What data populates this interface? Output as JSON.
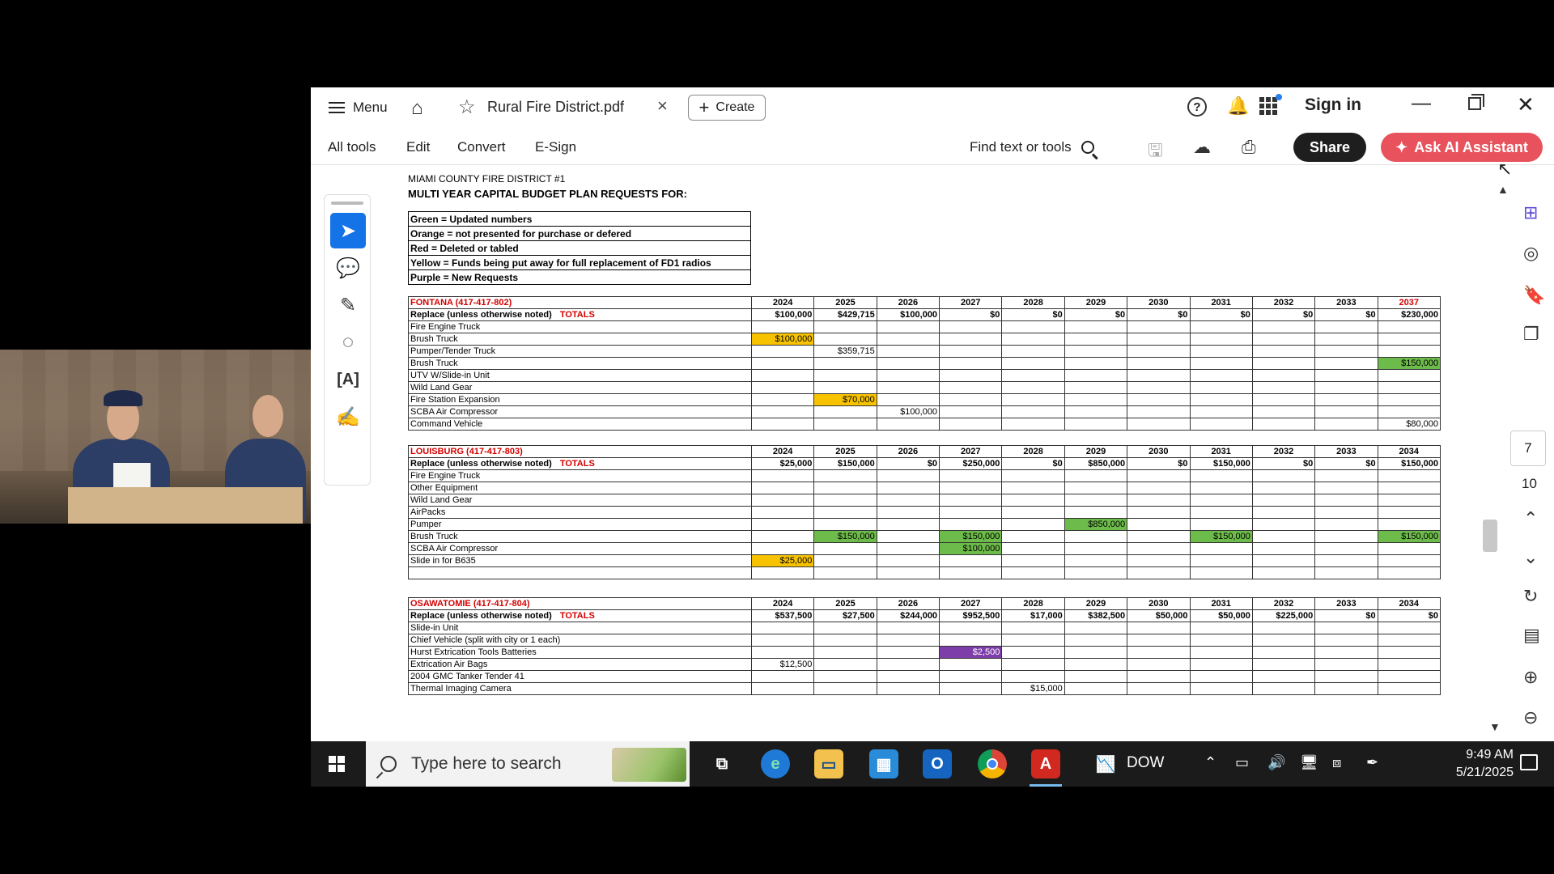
{
  "titlebar": {
    "menu_label": "Menu",
    "doc_tab": "Rural Fire District.pdf",
    "create_label": "Create",
    "help_symbol": "?",
    "signin_label": "Sign in"
  },
  "toolbar": {
    "menus": [
      "All tools",
      "Edit",
      "Convert",
      "E-Sign"
    ],
    "find_label": "Find text or tools",
    "share_label": "Share",
    "ai_label": "Ask AI Assistant",
    "accent_red": "#e8525c"
  },
  "page_nav": {
    "current": "7",
    "total": "10"
  },
  "document": {
    "header1": "MIAMI COUNTY FIRE DISTRICT #1",
    "header2": "MULTI YEAR CAPITAL BUDGET PLAN REQUESTS FOR:",
    "legend": [
      "Green = Updated numbers",
      "Orange = not presented for purchase or defered",
      "Red = Deleted or tabled",
      "Yellow = Funds being put away for full replacement of FD1 radios",
      "Purple = New Requests"
    ],
    "totals_word": "TOTALS",
    "fontana": {
      "title": "FONTANA (417-417-802)",
      "years": [
        "2024",
        "2025",
        "2026",
        "2027",
        "2028",
        "2029",
        "2030",
        "2031",
        "2032",
        "2033",
        "2037"
      ],
      "totals_label": "Replace (unless otherwise noted)",
      "totals": [
        "$100,000",
        "$429,715",
        "$100,000",
        "$0",
        "$0",
        "$0",
        "$0",
        "$0",
        "$0",
        "$0",
        "$230,000"
      ],
      "rows": [
        {
          "label": "Fire Engine Truck",
          "values": [
            "",
            "",
            "",
            "",
            "",
            "",
            "",
            "",
            "",
            "",
            ""
          ]
        },
        {
          "label": "Brush Truck",
          "values": [
            "$100,000",
            "",
            "",
            "",
            "",
            "",
            "",
            "",
            "",
            "",
            ""
          ]
        },
        {
          "label": "Pumper/Tender Truck",
          "values": [
            "",
            "$359,715",
            "",
            "",
            "",
            "",
            "",
            "",
            "",
            "",
            ""
          ]
        },
        {
          "label": "Brush Truck",
          "values": [
            "",
            "",
            "",
            "",
            "",
            "",
            "",
            "",
            "",
            "",
            "$150,000"
          ]
        },
        {
          "label": "UTV W/Slide-in Unit",
          "values": [
            "",
            "",
            "",
            "",
            "",
            "",
            "",
            "",
            "",
            "",
            ""
          ]
        },
        {
          "label": "Wild Land Gear",
          "values": [
            "",
            "",
            "",
            "",
            "",
            "",
            "",
            "",
            "",
            "",
            ""
          ]
        },
        {
          "label": "Fire Station Expansion",
          "values": [
            "",
            "$70,000",
            "",
            "",
            "",
            "",
            "",
            "",
            "",
            "",
            ""
          ]
        },
        {
          "label": "SCBA Air Compressor",
          "values": [
            "",
            "",
            "$100,000",
            "",
            "",
            "",
            "",
            "",
            "",
            "",
            ""
          ]
        },
        {
          "label": "Command Vehicle",
          "values": [
            "",
            "",
            "",
            "",
            "",
            "",
            "",
            "",
            "",
            "",
            "$80,000"
          ]
        }
      ]
    },
    "louisburg": {
      "title": "LOUISBURG (417-417-803)",
      "years": [
        "2024",
        "2025",
        "2026",
        "2027",
        "2028",
        "2029",
        "2030",
        "2031",
        "2032",
        "2033",
        "2034"
      ],
      "totals_label": "Replace (unless otherwise noted)",
      "totals": [
        "$25,000",
        "$150,000",
        "$0",
        "$250,000",
        "$0",
        "$850,000",
        "$0",
        "$150,000",
        "$0",
        "$0",
        "$150,000"
      ],
      "rows": [
        {
          "label": "Fire Engine Truck",
          "values": [
            "",
            "",
            "",
            "",
            "",
            "",
            "",
            "",
            "",
            "",
            ""
          ]
        },
        {
          "label": "Other Equipment",
          "values": [
            "",
            "",
            "",
            "",
            "",
            "",
            "",
            "",
            "",
            "",
            ""
          ]
        },
        {
          "label": "Wild Land Gear",
          "values": [
            "",
            "",
            "",
            "",
            "",
            "",
            "",
            "",
            "",
            "",
            ""
          ]
        },
        {
          "label": "AirPacks",
          "values": [
            "",
            "",
            "",
            "",
            "",
            "",
            "",
            "",
            "",
            "",
            ""
          ]
        },
        {
          "label": "Pumper",
          "values": [
            "",
            "",
            "",
            "",
            "",
            "$850,000",
            "",
            "",
            "",
            "",
            ""
          ]
        },
        {
          "label": "Brush Truck",
          "values": [
            "",
            "$150,000",
            "",
            "$150,000",
            "",
            "",
            "",
            "$150,000",
            "",
            "",
            "$150,000"
          ]
        },
        {
          "label": "SCBA Air Compressor",
          "values": [
            "",
            "",
            "",
            "$100,000",
            "",
            "",
            "",
            "",
            "",
            "",
            ""
          ]
        },
        {
          "label": "Slide in for B635",
          "values": [
            "$25,000",
            "",
            "",
            "",
            "",
            "",
            "",
            "",
            "",
            "",
            ""
          ]
        },
        {
          "label": "",
          "values": [
            "",
            "",
            "",
            "",
            "",
            "",
            "",
            "",
            "",
            "",
            ""
          ]
        }
      ]
    },
    "osawatomie": {
      "title": "OSAWATOMIE (417-417-804)",
      "years": [
        "2024",
        "2025",
        "2026",
        "2027",
        "2028",
        "2029",
        "2030",
        "2031",
        "2032",
        "2033",
        "2034"
      ],
      "totals_label": "Replace (unless otherwise noted)",
      "totals": [
        "$537,500",
        "$27,500",
        "$244,000",
        "$952,500",
        "$17,000",
        "$382,500",
        "$50,000",
        "$50,000",
        "$225,000",
        "$0",
        "$0"
      ],
      "rows": [
        {
          "label": "Slide-in Unit",
          "values": [
            "",
            "",
            "",
            "",
            "",
            "",
            "",
            "",
            "",
            "",
            ""
          ]
        },
        {
          "label": "Chief Vehicle (split with city or 1 each)",
          "values": [
            "",
            "",
            "",
            "",
            "",
            "",
            "",
            "",
            "",
            "",
            ""
          ]
        },
        {
          "label": "Hurst Extrication Tools Batteries",
          "values": [
            "",
            "",
            "",
            "$2,500",
            "",
            "",
            "",
            "",
            "",
            "",
            ""
          ]
        },
        {
          "label": "Extrication Air Bags",
          "values": [
            "$12,500",
            "",
            "",
            "",
            "",
            "",
            "",
            "",
            "",
            "",
            ""
          ]
        },
        {
          "label": "2004 GMC Tanker Tender 41",
          "values": [
            "",
            "",
            "",
            "",
            "",
            "",
            "",
            "",
            "",
            "",
            ""
          ]
        },
        {
          "label": "Thermal Imaging Camera",
          "values": [
            "",
            "",
            "",
            "",
            "$15,000",
            "",
            "",
            "",
            "",
            "",
            ""
          ]
        }
      ]
    },
    "cell_colors": {
      "yellow": "#f7c300",
      "green": "#6dbb4a",
      "purple": "#7e3eaa",
      "red_text": "#d40000"
    }
  },
  "taskbar": {
    "search_placeholder": "Type here to search",
    "dow_label": "DOW",
    "time": "9:49 AM",
    "date": "5/21/2025"
  }
}
